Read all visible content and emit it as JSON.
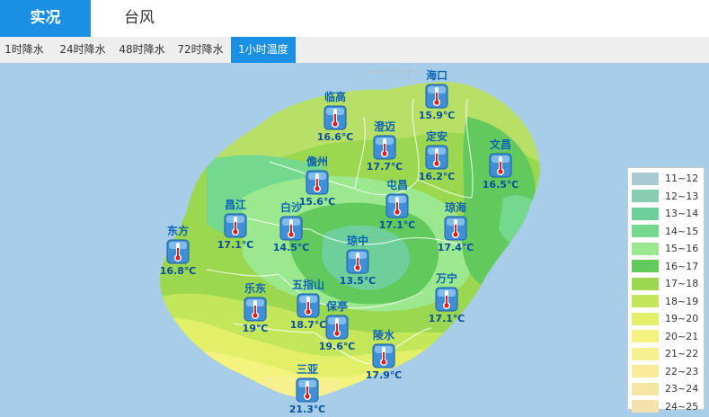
{
  "top_tabs": [
    {
      "label": "实况",
      "active": true
    },
    {
      "label": "台风",
      "active": false
    }
  ],
  "sub_tabs": [
    {
      "label": "1时降水",
      "active": false
    },
    {
      "label": "24时降水",
      "active": false
    },
    {
      "label": "48时降水",
      "active": false
    },
    {
      "label": "72时降水",
      "active": false
    },
    {
      "label": "1小时温度",
      "active": true
    }
  ],
  "stations": [
    {
      "name": "海口",
      "temp": "15.9℃"
    },
    {
      "name": "临高",
      "temp": "16.6℃"
    },
    {
      "name": "澄迈",
      "temp": "17.7℃"
    },
    {
      "name": "定安",
      "temp": "16.2℃"
    },
    {
      "name": "文昌",
      "temp": "16.5℃"
    },
    {
      "name": "儋州",
      "temp": "15.6℃"
    },
    {
      "name": "屯昌",
      "temp": "17.1℃"
    },
    {
      "name": "昌江",
      "temp": "17.1℃"
    },
    {
      "name": "白沙",
      "temp": "14.5℃"
    },
    {
      "name": "琼海",
      "temp": "17.4℃"
    },
    {
      "name": "东方",
      "temp": "16.8℃"
    },
    {
      "name": "琼中",
      "temp": "13.5℃"
    },
    {
      "name": "乐东",
      "temp": "19℃"
    },
    {
      "name": "五指山",
      "temp": "18.7℃"
    },
    {
      "name": "万宁",
      "temp": "17.1℃"
    },
    {
      "name": "保亭",
      "temp": "19.6℃"
    },
    {
      "name": "陵水",
      "temp": "17.9℃"
    },
    {
      "name": "三亚",
      "temp": "21.3℃"
    }
  ],
  "legend": [
    {
      "label": "11~12",
      "color": "#a9c9d4"
    },
    {
      "label": "12~13",
      "color": "#86cdb2"
    },
    {
      "label": "13~14",
      "color": "#6fcf9a"
    },
    {
      "label": "14~15",
      "color": "#74d98e"
    },
    {
      "label": "15~16",
      "color": "#9be88f"
    },
    {
      "label": "16~17",
      "color": "#62c95c"
    },
    {
      "label": "17~18",
      "color": "#9bd84f"
    },
    {
      "label": "18~19",
      "color": "#c4e65b"
    },
    {
      "label": "19~20",
      "color": "#e2ef69"
    },
    {
      "label": "20~21",
      "color": "#f3f37e"
    },
    {
      "label": "21~22",
      "color": "#f7f08e"
    },
    {
      "label": "22~23",
      "color": "#f8ec9a"
    },
    {
      "label": "23~24",
      "color": "#f6e6a4"
    },
    {
      "label": "24~25",
      "color": "#f4e1ae"
    }
  ],
  "colors": {
    "accent": "#1a8fe3",
    "sea": "#a8cde8",
    "station_label": "#0b63b8"
  },
  "icons": {
    "station_marker": "thermometer-icon"
  }
}
